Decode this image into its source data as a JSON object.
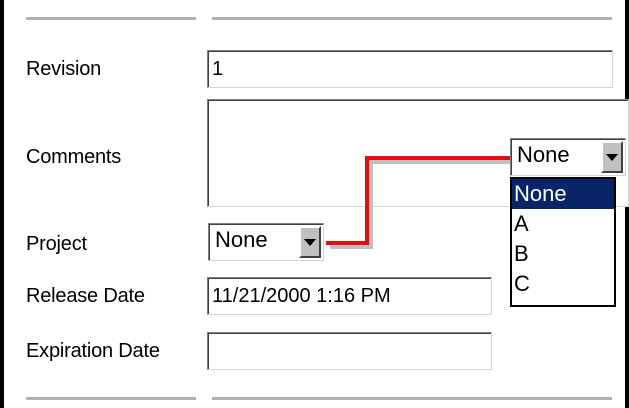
{
  "form": {
    "revision": {
      "label": "Revision",
      "value": "1"
    },
    "comments": {
      "label": "Comments",
      "value": ""
    },
    "comments_dropdown": {
      "selected": "None",
      "options": [
        "None",
        "A",
        "B",
        "C"
      ]
    },
    "project": {
      "label": "Project",
      "selected": "None"
    },
    "release_date": {
      "label": "Release Date",
      "value": "11/21/2000 1:16 PM"
    },
    "expiration_date": {
      "label": "Expiration Date",
      "value": ""
    }
  },
  "colors": {
    "connector": "#e01010",
    "selection": "#0a246a"
  }
}
